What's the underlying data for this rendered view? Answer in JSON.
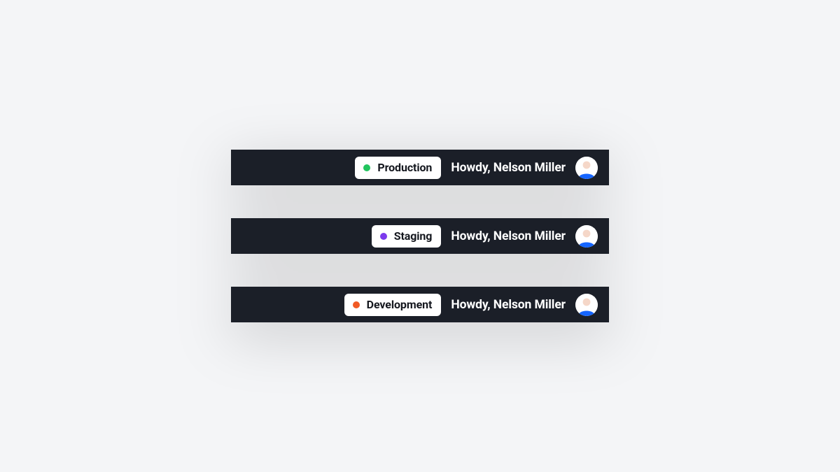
{
  "greeting": "Howdy, Nelson Miller",
  "avatar": {
    "shirt": "#1565ff",
    "skin": "#f5d7c8",
    "bg": "#ffffff"
  },
  "bars": [
    {
      "env_label": "Production",
      "dot_color": "#22c55e"
    },
    {
      "env_label": "Staging",
      "dot_color": "#7c3aed"
    },
    {
      "env_label": "Development",
      "dot_color": "#f15a24"
    }
  ]
}
